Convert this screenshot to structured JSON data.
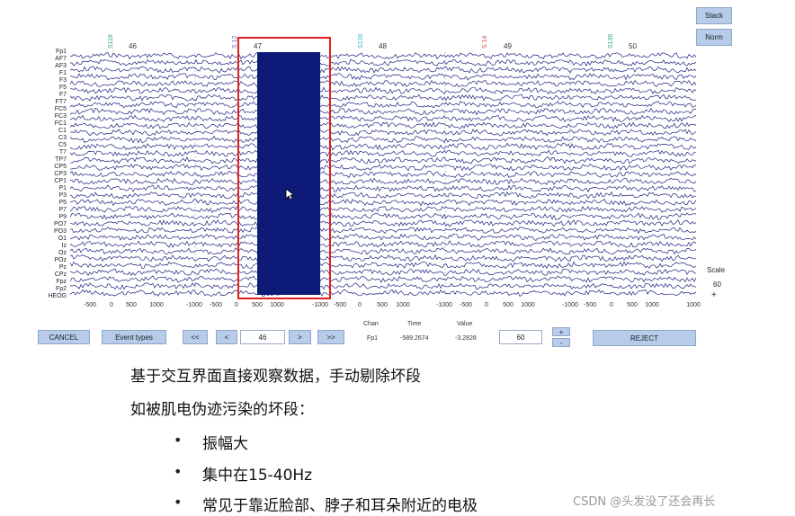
{
  "toolbar_right": {
    "stack_label": "Stack",
    "norm_label": "Norm"
  },
  "epochs": [
    "46",
    "47",
    "48",
    "49",
    "50"
  ],
  "events": [
    {
      "label": "S118",
      "color": "#3aa86b"
    },
    {
      "label": "S 12",
      "color": "#6a6ac8"
    },
    {
      "label": "S136",
      "color": "#2fb8d8"
    },
    {
      "label": "S 14",
      "color": "#d84a4a"
    },
    {
      "label": "S136",
      "color": "#3aa86b"
    }
  ],
  "channels": [
    "Fp1",
    "AF7",
    "AF3",
    "F1",
    "F3",
    "F5",
    "F7",
    "FT7",
    "FC5",
    "FC3",
    "FC1",
    "C1",
    "C3",
    "C5",
    "T7",
    "TP7",
    "CP5",
    "CP3",
    "CP1",
    "P1",
    "P3",
    "P5",
    "P7",
    "P9",
    "PO7",
    "PO3",
    "O1",
    "Iz",
    "Oz",
    "POz",
    "Pz",
    "CPz",
    "Fpz",
    "Fp2",
    "HEOG"
  ],
  "x_ticks": [
    "-500",
    "0",
    "500",
    "1000",
    "-1000",
    "-500",
    "0",
    "500",
    "1000",
    "-1000",
    "-500",
    "0",
    "500",
    "1000",
    "-1000",
    "-500",
    "0",
    "500",
    "1000",
    "-1000",
    "-500",
    "0",
    "500",
    "1000",
    "1000"
  ],
  "scale": {
    "label": "Scale",
    "value": "60",
    "symbol": "+"
  },
  "bottom_bar": {
    "cancel": "CANCEL",
    "event_types": "Event types",
    "prev_fast": "<<",
    "prev": "<",
    "epoch_field": "46",
    "next": ">",
    "next_fast": ">>",
    "chan_header": "Chan",
    "time_header": "Time",
    "value_header": "Value",
    "chan_value": "Fp1",
    "time_value": "-589.2674",
    "value_value": "-3.2828",
    "scale_field": "60",
    "plus": "+",
    "minus": "-",
    "reject": "REJECT"
  },
  "notes": {
    "line1": "基于交互界面直接观察数据，手动剔除坏段",
    "line2": "如被肌电伪迹污染的坏段：",
    "bullets": [
      "振幅大",
      "集中在15-40Hz",
      "常见于靠近脸部、脖子和耳朵附近的电极"
    ]
  },
  "watermark": "CSDN @头发没了还会再长",
  "colors": {
    "trace": "#1a237e",
    "artifact": "#0d1a78",
    "highlight": "#e02020",
    "button": "#b8cbe8"
  }
}
